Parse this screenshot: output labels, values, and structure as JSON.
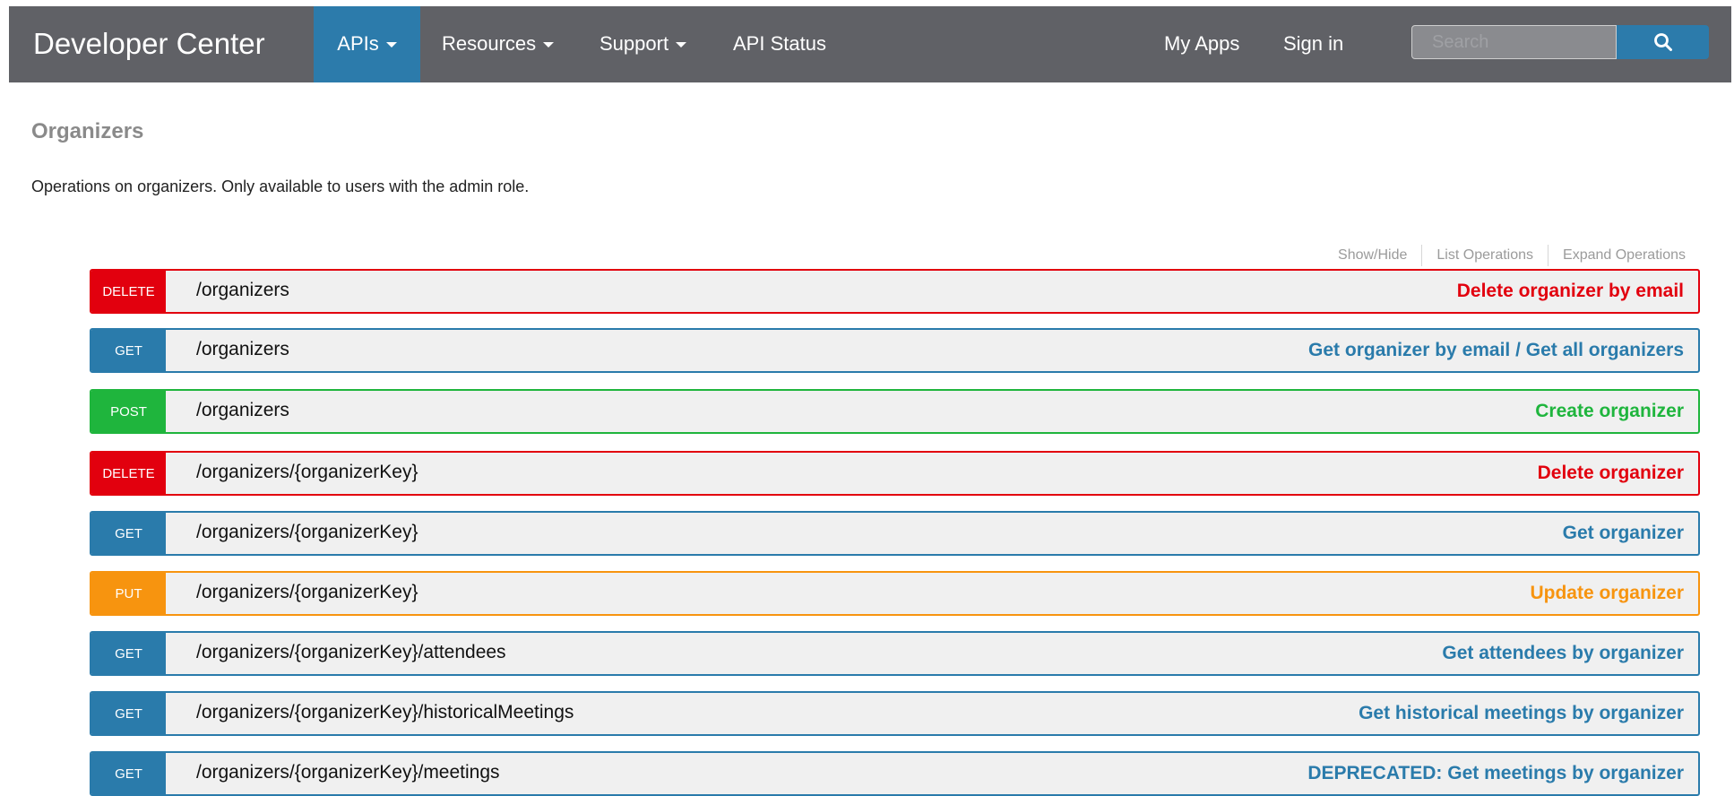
{
  "nav": {
    "brand": "Developer Center",
    "apis_label": "APIs",
    "resources_label": "Resources",
    "support_label": "Support",
    "api_status_label": "API Status",
    "my_apps_label": "My Apps",
    "sign_in_label": "Sign in",
    "search_placeholder": "Search",
    "search_icon": "search-icon",
    "active_color": "#2c7bab",
    "bar_color": "#606166"
  },
  "section": {
    "title": "Organizers",
    "description": "Operations on organizers. Only available to users with the admin role."
  },
  "toolbar": {
    "show_hide": "Show/Hide",
    "list_operations": "List Operations",
    "expand_operations": "Expand Operations"
  },
  "method_colors": {
    "DELETE": "#e2000e",
    "GET": "#2a7bab",
    "POST": "#1fb53d",
    "PUT": "#f7940f"
  },
  "operations": [
    {
      "method": "DELETE",
      "path": "/organizers",
      "summary": "Delete organizer by email"
    },
    {
      "method": "GET",
      "path": "/organizers",
      "summary": "Get organizer by email / Get all organizers"
    },
    {
      "method": "POST",
      "path": "/organizers",
      "summary": "Create organizer"
    },
    {
      "method": "DELETE",
      "path": "/organizers/{organizerKey}",
      "summary": "Delete organizer"
    },
    {
      "method": "GET",
      "path": "/organizers/{organizerKey}",
      "summary": "Get organizer"
    },
    {
      "method": "PUT",
      "path": "/organizers/{organizerKey}",
      "summary": "Update organizer"
    },
    {
      "method": "GET",
      "path": "/organizers/{organizerKey}/attendees",
      "summary": "Get attendees by organizer"
    },
    {
      "method": "GET",
      "path": "/organizers/{organizerKey}/historicalMeetings",
      "summary": "Get historical meetings by organizer"
    },
    {
      "method": "GET",
      "path": "/organizers/{organizerKey}/meetings",
      "summary": "DEPRECATED: Get meetings by organizer"
    }
  ]
}
